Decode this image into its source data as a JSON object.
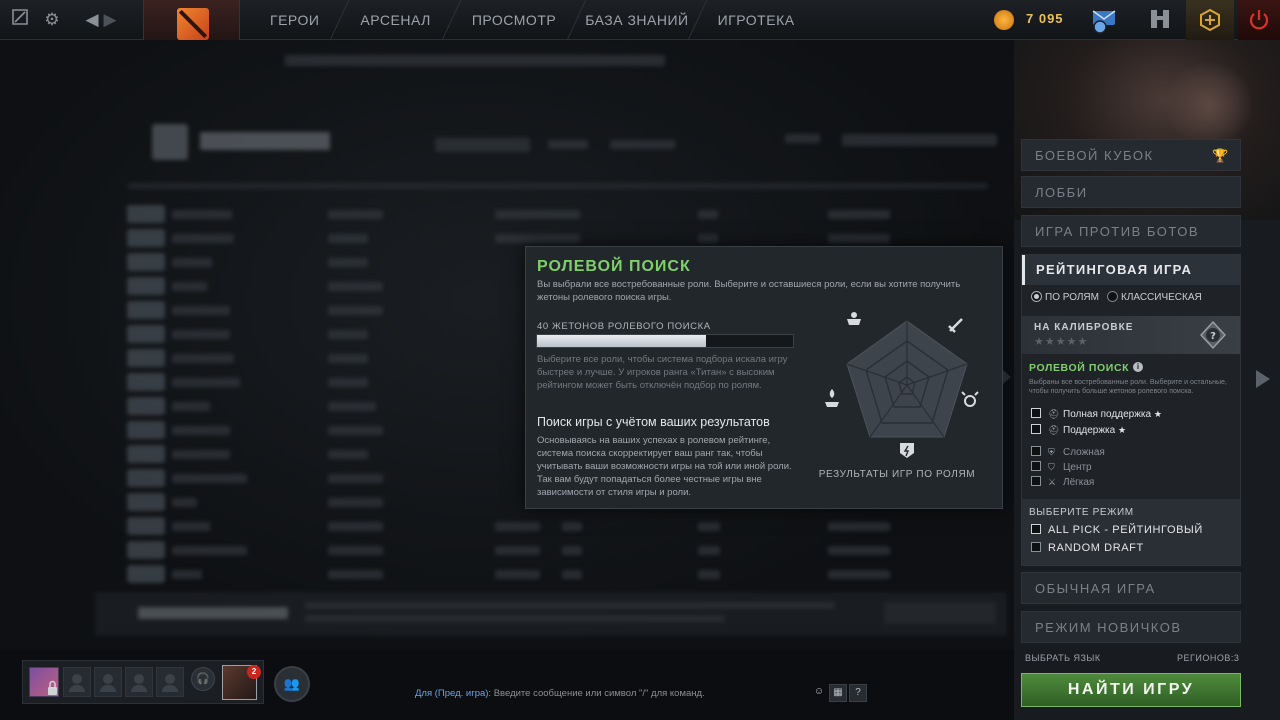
{
  "topbar": {
    "nav": [
      "ГЕРОИ",
      "АРСЕНАЛ",
      "ПРОСМОТР",
      "БАЗА ЗНАНИЙ",
      "ИГРОТЕКА"
    ],
    "currency_amount": "7 095",
    "icons": {
      "dashboard": "dashboard-icon",
      "settings": "gear-icon",
      "back": "arrow-left-icon",
      "forward": "arrow-right-icon",
      "logo": "dota-logo-icon",
      "shards": "shards-icon",
      "chat": "chat-icon",
      "armory": "armory-icon",
      "plus": "dota-plus-icon",
      "power": "power-icon"
    },
    "colors": {
      "currency": "#e9c35a",
      "power": "#c9271e"
    }
  },
  "popup": {
    "title": "РОЛЕВОЙ ПОИСК",
    "description": "Вы выбрали все востребованные роли. Выберите и оставшиеся роли, если вы хотите получить жетоны ролевого поиска игры.",
    "tokens_label": "40 ЖЕТОНОВ РОЛЕВОГО ПОИСКА",
    "tokens_progress": 0.66,
    "note": "Выберите все роли, чтобы система подбора искала игру быстрее и лучше. У игроков ранга «Титан» с высоким рейтингом может быть отключён подбор по ролям.",
    "subtitle": "Поиск игры с учётом ваших результатов",
    "subtitle_desc": "Основываясь на ваших успехах в ролевом рейтинге, система поиска скорректирует ваш ранг так, чтобы учитывать ваши возможности игры на той или иной роли. Так вам будут попадаться более честные игры вне зависимости от стиля игры и роли.",
    "radar_label": "РЕЗУЛЬТАТЫ ИГР ПО РОЛЯМ",
    "colors": {
      "title": "#7fd06b"
    }
  },
  "right_panel": {
    "modes_top": [
      "БОЕВОЙ КУБОК",
      "ЛОББИ",
      "ИГРА ПРОТИВ БОТОВ"
    ],
    "ranked": {
      "title": "РЕЙТИНГОВАЯ ИГРА",
      "radio_roles": "ПО РОЛЯМ",
      "radio_classic": "КЛАССИЧЕСКАЯ",
      "calibration": "НА КАЛИБРОВКЕ",
      "calibration_stars": "★★★★★",
      "role_search_title": "РОЛЕВОЙ ПОИСК",
      "role_search_desc": "Выбраны все востребованные роли. Выберите и остальные, чтобы получить больше жетонов ролевого поиска.",
      "roles": [
        {
          "label": "Полная поддержка",
          "checked": true
        },
        {
          "label": "Поддержка",
          "checked": true
        },
        {
          "label": "Сложная",
          "checked": false
        },
        {
          "label": "Центр",
          "checked": false
        },
        {
          "label": "Лёгкая",
          "checked": false
        }
      ],
      "select_mode_title": "ВЫБЕРИТЕ РЕЖИМ",
      "mode_options": [
        {
          "label": "ALL PICK - РЕЙТИНГОВЫЙ",
          "checked": true
        },
        {
          "label": "RANDOM DRAFT",
          "checked": false
        }
      ]
    },
    "modes_bottom": [
      "ОБЫЧНАЯ ИГРА",
      "РЕЖИМ НОВИЧКОВ"
    ],
    "footer_language": "ВЫБРАТЬ ЯЗЫК",
    "footer_regions": "РЕГИОНОВ:3",
    "find_button": "НАЙТИ ИГРУ",
    "colors": {
      "find_button": "#4f8b3c",
      "role_title": "#7fd06b"
    }
  },
  "bottom": {
    "friend_badge": "2",
    "chat_channel": "Для (Пред. игра):",
    "chat_placeholder": " Введите сообщение или символ \"/\" для команд.",
    "chat_help": "?"
  }
}
